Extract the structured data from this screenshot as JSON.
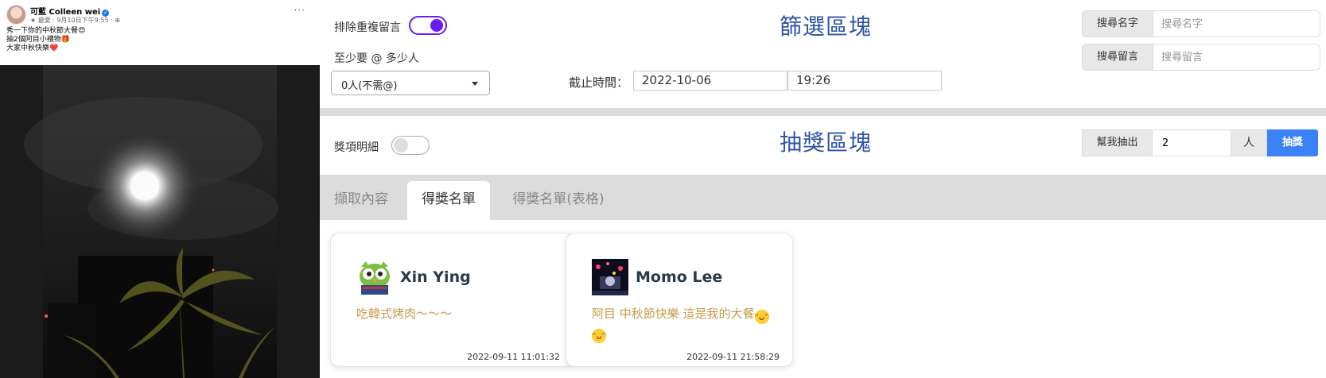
{
  "post": {
    "author": "可藍 Colleen wei",
    "meta": "★ 最愛 · 9月10日下午9:55 · ⊕",
    "lines": [
      "秀一下你的中秋節大餐😍",
      "抽2個阿目小禮物🎁",
      "大家中秋快樂❤️"
    ],
    "more": "···"
  },
  "filter": {
    "title": "篩選區塊",
    "dedupe_label": "排除重複留言",
    "dedupe_on": true,
    "min_mentions_label": "至少要 @ 多少人",
    "min_mentions_value": "0人(不需@)",
    "deadline_label": "截止時間：",
    "deadline_date": "2022-10-06",
    "deadline_time": "19:26",
    "search_name_label": "搜尋名字",
    "search_name_placeholder": "搜尋名字",
    "search_comment_label": "搜尋留言",
    "search_comment_placeholder": "搜尋留言"
  },
  "draw": {
    "title": "抽獎區塊",
    "detail_label": "獎項明細",
    "detail_on": false,
    "pick_label": "幫我抽出",
    "pick_count": "2",
    "unit": "人",
    "button": "抽獎"
  },
  "tabs": [
    {
      "label": "擷取內容",
      "active": false
    },
    {
      "label": "得獎名單",
      "active": true
    },
    {
      "label": "得獎名單(表格)",
      "active": false
    }
  ],
  "winners": [
    {
      "name": "Xin Ying",
      "message": "吃韓式烤肉～～～",
      "time": "2022-09-11 11:01:32",
      "avatar": "owl-avatar"
    },
    {
      "name": "Momo Lee",
      "message": "阿目 中秋節快樂 這是我的大餐",
      "time": "2022-09-11 21:58:29",
      "avatar": "night-lights-avatar"
    }
  ],
  "colors": {
    "accent_purple": "#6b1cf0",
    "title_blue": "#2f54a6",
    "button_blue": "#3b82f6",
    "message_gold": "#c79a4d"
  }
}
